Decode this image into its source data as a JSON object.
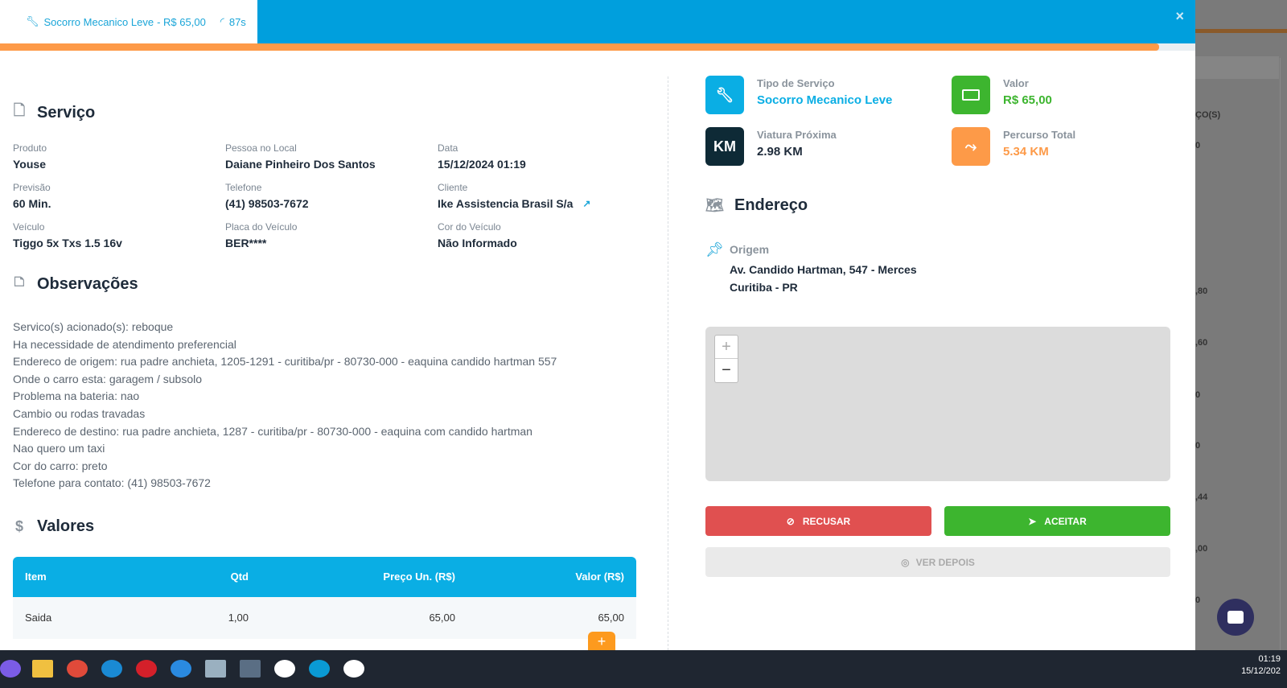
{
  "tab": {
    "title": "Socorro Mecanico Leve",
    "price": " - R$ 65,00",
    "timer": "87s"
  },
  "close": "×",
  "progress_percent": 97,
  "servico": {
    "title": "Serviço",
    "fields": [
      {
        "label": "Produto",
        "value": "Youse"
      },
      {
        "label": "Pessoa no Local",
        "value": "Daiane Pinheiro Dos Santos"
      },
      {
        "label": "Data",
        "value": "15/12/2024 01:19"
      },
      {
        "label": "Previsão",
        "value": "60 Min."
      },
      {
        "label": "Telefone",
        "value": "(41) 98503-7672"
      },
      {
        "label": "Cliente",
        "value": "Ike Assistencia Brasil S/a"
      },
      {
        "label": "Veículo",
        "value": "Tiggo 5x Txs 1.5 16v"
      },
      {
        "label": "Placa do Veículo",
        "value": "BER****"
      },
      {
        "label": "Cor do Veículo",
        "value": "Não Informado"
      }
    ]
  },
  "observacoes": {
    "title": "Observações",
    "lines": [
      "Servico(s) acionado(s): reboque",
      "Ha necessidade de atendimento preferencial",
      "Endereco de origem: rua padre anchieta, 1205-1291 - curitiba/pr - 80730-000 - eaquina candido hartman 557",
      "Onde o carro esta: garagem / subsolo",
      "Problema na bateria: nao",
      "Cambio ou rodas travadas",
      "Endereco de destino: rua padre anchieta, 1287 - curitiba/pr - 80730-000 - eaquina com candido hartman",
      "Nao quero um taxi",
      "Cor do carro: preto",
      "Telefone para contato: (41) 98503-7672"
    ]
  },
  "valores": {
    "title": "Valores",
    "headers": [
      "Item",
      "Qtd",
      "Preço Un. (R$)",
      "Valor (R$)"
    ],
    "rows": [
      [
        "Saida",
        "1,00",
        "65,00",
        "65,00"
      ]
    ]
  },
  "stats": [
    {
      "label": "Tipo de Serviço",
      "value": "Socorro Mecanico Leve",
      "color": "#0aaee4",
      "icon": "KM"
    },
    {
      "label": "Valor",
      "value": "R$ 65,00",
      "color": "#3db52f"
    },
    {
      "label": "Viatura Próxima",
      "value": "2.98 KM",
      "color": "#0e2a36",
      "icon_text": "KM"
    },
    {
      "label": "Percurso Total",
      "value": "5.34 KM",
      "color": "#fd9a48"
    }
  ],
  "endereco": {
    "title": "Endereço",
    "origem_label": "Origem",
    "line1": "Av. Candido Hartman, 547 - Merces",
    "line2": "Curitiba - PR"
  },
  "map": {
    "zoom_in": "+",
    "zoom_out": "−"
  },
  "buttons": {
    "recusar": "RECUSAR",
    "aceitar": "ACEITAR",
    "ver_depois": "VER DEPOIS"
  },
  "background": {
    "header": "ÇO(S)",
    "values": [
      "0",
      ",80",
      ",60",
      "0",
      "0",
      ",44",
      ",00",
      "0"
    ]
  },
  "taskbar": {
    "time": "01:19",
    "date": "15/12/202"
  }
}
